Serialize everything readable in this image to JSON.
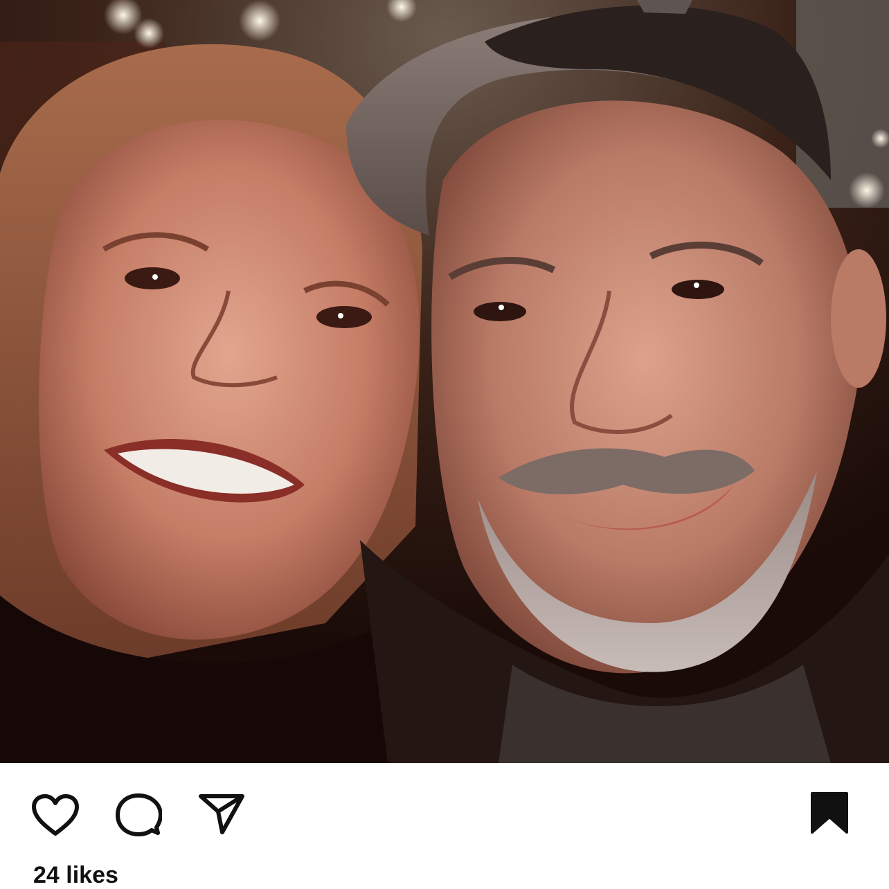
{
  "post": {
    "image": {
      "subject": "selfie-two-people"
    },
    "actions": {
      "like_icon": "heart-outline-icon",
      "comment_icon": "comment-bubble-icon",
      "share_icon": "paper-plane-icon",
      "save_icon": "bookmark-filled-icon"
    },
    "likes_text": "24 likes"
  },
  "colors": {
    "icon": "#111111",
    "background": "#ffffff"
  }
}
